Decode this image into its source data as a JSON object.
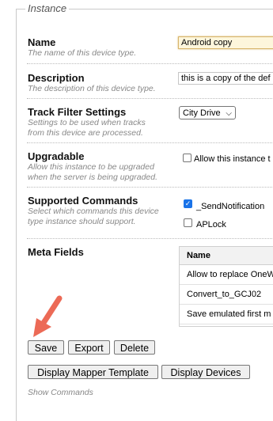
{
  "legend": "Instance",
  "fields": {
    "name": {
      "label": "Name",
      "desc": "The name of this device type.",
      "value": "Android copy"
    },
    "description": {
      "label": "Description",
      "desc": "The description of this device type.",
      "value": "this is a copy of the def"
    },
    "track_filter": {
      "label": "Track Filter Settings",
      "desc_line1": "Settings to be used when tracks",
      "desc_line2": "from this device are processed.",
      "selected": "City Drive"
    },
    "upgradable": {
      "label": "Upgradable",
      "desc_line1": "Allow this instance to be upgraded",
      "desc_line2": "when the server is being upgraded.",
      "checkbox_label": "Allow this instance t"
    },
    "supported_commands": {
      "label": "Supported Commands",
      "desc_line1": "Select which commands this device",
      "desc_line2": "type instance should support.",
      "commands": [
        {
          "label": "_SendNotification",
          "checked": true
        },
        {
          "label": "APLock",
          "checked": false
        }
      ]
    },
    "meta_fields": {
      "label": "Meta Fields",
      "column": "Name",
      "rows": [
        "Allow to replace OneW",
        "Convert_to_GCJ02",
        "Save emulated first m"
      ]
    }
  },
  "buttons": {
    "save": "Save",
    "export": "Export",
    "delete": "Delete",
    "mapper": "Display Mapper Template",
    "devices": "Display Devices"
  },
  "footer": "Show Commands"
}
